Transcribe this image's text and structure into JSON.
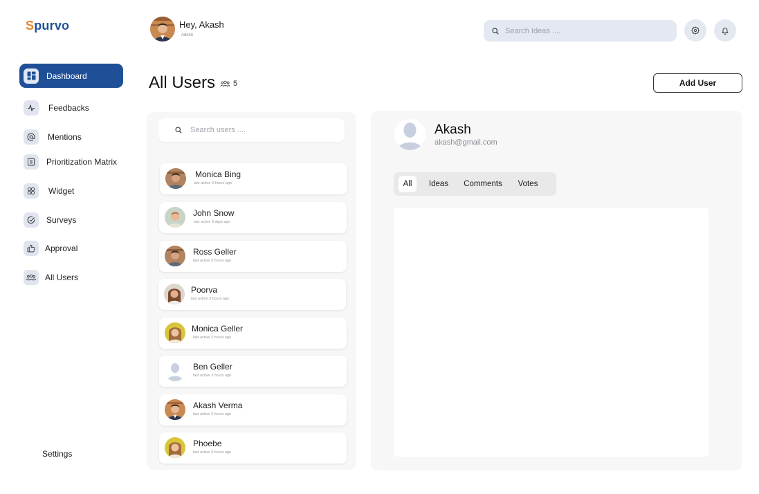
{
  "brand": {
    "first_letter": "S",
    "rest": "purvo"
  },
  "sidebar": {
    "items": [
      {
        "label": "Dashboard",
        "icon": "dashboard-icon",
        "active": true
      },
      {
        "label": "Feedbacks",
        "icon": "activity-icon"
      },
      {
        "label": "Mentions",
        "icon": "at-icon"
      },
      {
        "label": "Prioritization Matrix",
        "icon": "matrix-icon"
      },
      {
        "label": "Widget",
        "icon": "widget-icon"
      },
      {
        "label": "Surveys",
        "icon": "check-circle-icon"
      },
      {
        "label": "Approval",
        "icon": "thumbs-up-icon"
      },
      {
        "label": "All Users",
        "icon": "users-icon"
      }
    ],
    "settings_label": "Settings"
  },
  "header": {
    "greeting": "Hey, Akash",
    "role": "Admin",
    "search_placeholder": "Search Ideas ....",
    "settings_icon": "gear-icon",
    "notifications_icon": "bell-icon"
  },
  "page": {
    "title": "All Users",
    "count": "5",
    "add_user_label": "Add User"
  },
  "user_list": {
    "search_placeholder": "Search users ....",
    "users": [
      {
        "name": "Monica Bing",
        "last_active": "last active 3 hours ago"
      },
      {
        "name": "John Snow",
        "last_active": "last active 3 days ago"
      },
      {
        "name": "Ross Geller",
        "last_active": "last active 3 hours ago"
      },
      {
        "name": "Poorva",
        "last_active": "last active 3 hours ago"
      },
      {
        "name": "Monica Geller",
        "last_active": "last active 3 hours ago"
      },
      {
        "name": "Ben Geller",
        "last_active": "last active 3 hours ago"
      },
      {
        "name": "Akash Verma",
        "last_active": "last active 3 hours ago"
      },
      {
        "name": "Phoebe",
        "last_active": "last active 3 hours ago"
      }
    ]
  },
  "detail": {
    "name": "Akash",
    "email": "akash@gmail.com",
    "tabs": [
      {
        "label": "All",
        "active": true
      },
      {
        "label": "Ideas"
      },
      {
        "label": "Comments"
      },
      {
        "label": "Votes"
      }
    ]
  },
  "colors": {
    "brand_orange": "#e8872c",
    "brand_blue": "#1f4f97",
    "panel_bg": "#f7f7f7",
    "search_bg": "#e3e8f1"
  }
}
